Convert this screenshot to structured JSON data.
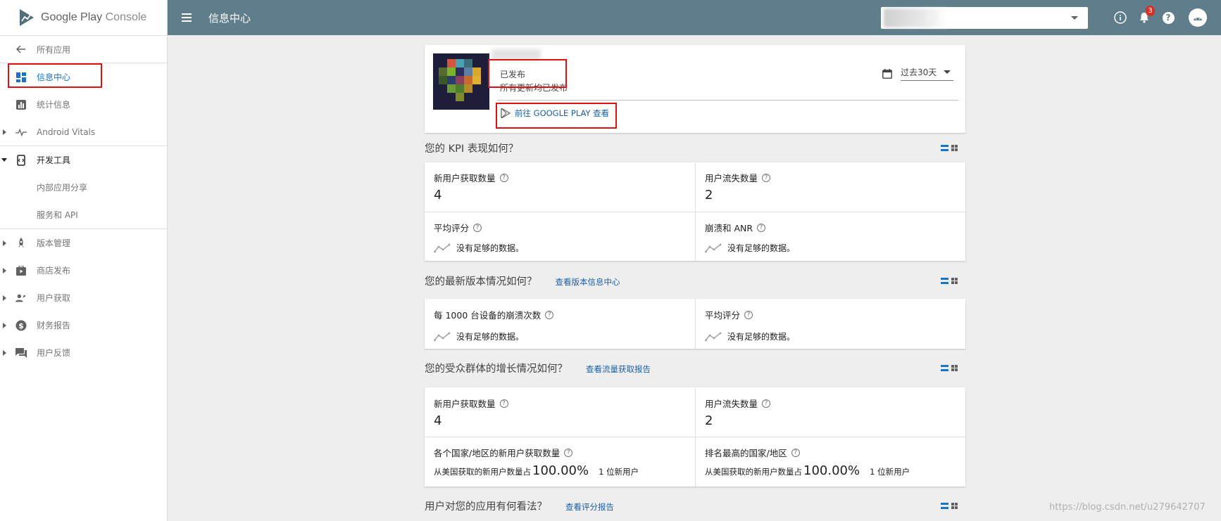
{
  "brand": {
    "name": "Google Play",
    "suffix": "Console"
  },
  "sidebar": {
    "back_label": "所有应用",
    "items": [
      {
        "label": "信息中心"
      },
      {
        "label": "统计信息"
      },
      {
        "label": "Android Vitals"
      },
      {
        "label": "开发工具"
      },
      {
        "label": "内部应用分享"
      },
      {
        "label": "服务和 API"
      },
      {
        "label": "版本管理"
      },
      {
        "label": "商店发布"
      },
      {
        "label": "用户获取"
      },
      {
        "label": "财务报告"
      },
      {
        "label": "用户反馈"
      }
    ]
  },
  "topbar": {
    "title": "信息中心",
    "notification_count": "3"
  },
  "app_card": {
    "status": "已发布",
    "status_detail": "所有更新均已发布",
    "play_link": "前往 GOOGLE PLAY 查看",
    "date_range": "过去30天"
  },
  "kpi": {
    "title": "您的 KPI 表现如何？",
    "new_users_label": "新用户获取数量",
    "new_users_value": "4",
    "lost_users_label": "用户流失数量",
    "lost_users_value": "2",
    "avg_rating_label": "平均评分",
    "crash_label": "崩溃和 ANR",
    "no_data": "没有足够的数据。"
  },
  "release": {
    "title": "您的最新版本情况如何？",
    "link": "查看版本信息中心",
    "crash_rate_label": "每 1000 台设备的崩溃次数",
    "avg_rating_label": "平均评分",
    "no_data": "没有足够的数据。"
  },
  "audience": {
    "title": "您的受众群体的增长情况如何？",
    "link": "查看流量获取报告",
    "new_users_label": "新用户获取数量",
    "new_users_value": "4",
    "lost_users_label": "用户流失数量",
    "lost_users_value": "2",
    "by_country_label": "各个国家/地区的新用户获取数量",
    "top_country_label": "排名最高的国家/地区",
    "pct_prefix": "从美国获取的新用户数量占",
    "pct_value": "100.00%",
    "pct_suffix": "1 位新用户"
  },
  "opinion": {
    "title": "用户对您的应用有何看法？",
    "link": "查看评分报告"
  },
  "watermark": "https://blog.csdn.net/u279642707",
  "colors": {
    "topbar": "#607d8b",
    "accent": "#1a73c7",
    "highlight": "#e01010"
  }
}
